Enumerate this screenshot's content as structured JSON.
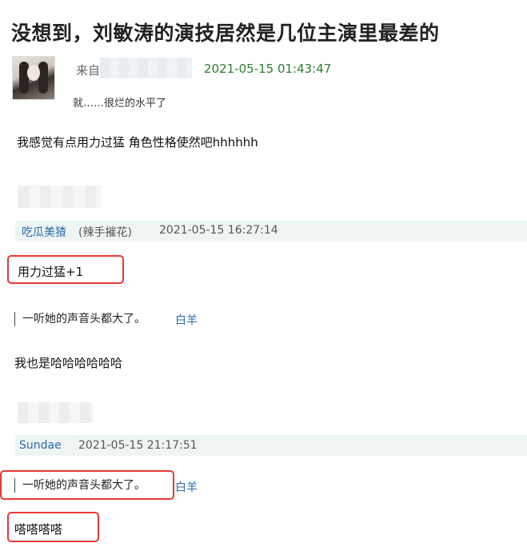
{
  "post": {
    "title": "没想到，刘敏涛的演技居然是几位主演里最差的",
    "from_label": "来自",
    "timestamp": "2021-05-15 01:43:47",
    "subtitle": "就……很烂的水平了"
  },
  "comment1": {
    "text": "我感觉有点用力过猛 角色性格使然吧hhhhhh"
  },
  "reply1": {
    "username": "吃瓜美猹",
    "role": "(辣手摧花)",
    "timestamp": "2021-05-15 16:27:14",
    "text": "用力过猛+1"
  },
  "quote1": {
    "text": "一听她的声音头都大了。",
    "author": "白羊"
  },
  "comment2": {
    "text": "我也是哈哈哈哈哈哈"
  },
  "reply2": {
    "username": "Sundae",
    "timestamp": "2021-05-15 21:17:51",
    "quote_text": "一听她的声音头都大了。",
    "quote_author": "白羊",
    "text": "嗒嗒嗒嗒"
  },
  "colors": {
    "highlight_box": "#e53935",
    "username": "#2b6aa8",
    "timestamp_green": "#2e7d32",
    "meta_band": "#eef4f4"
  }
}
